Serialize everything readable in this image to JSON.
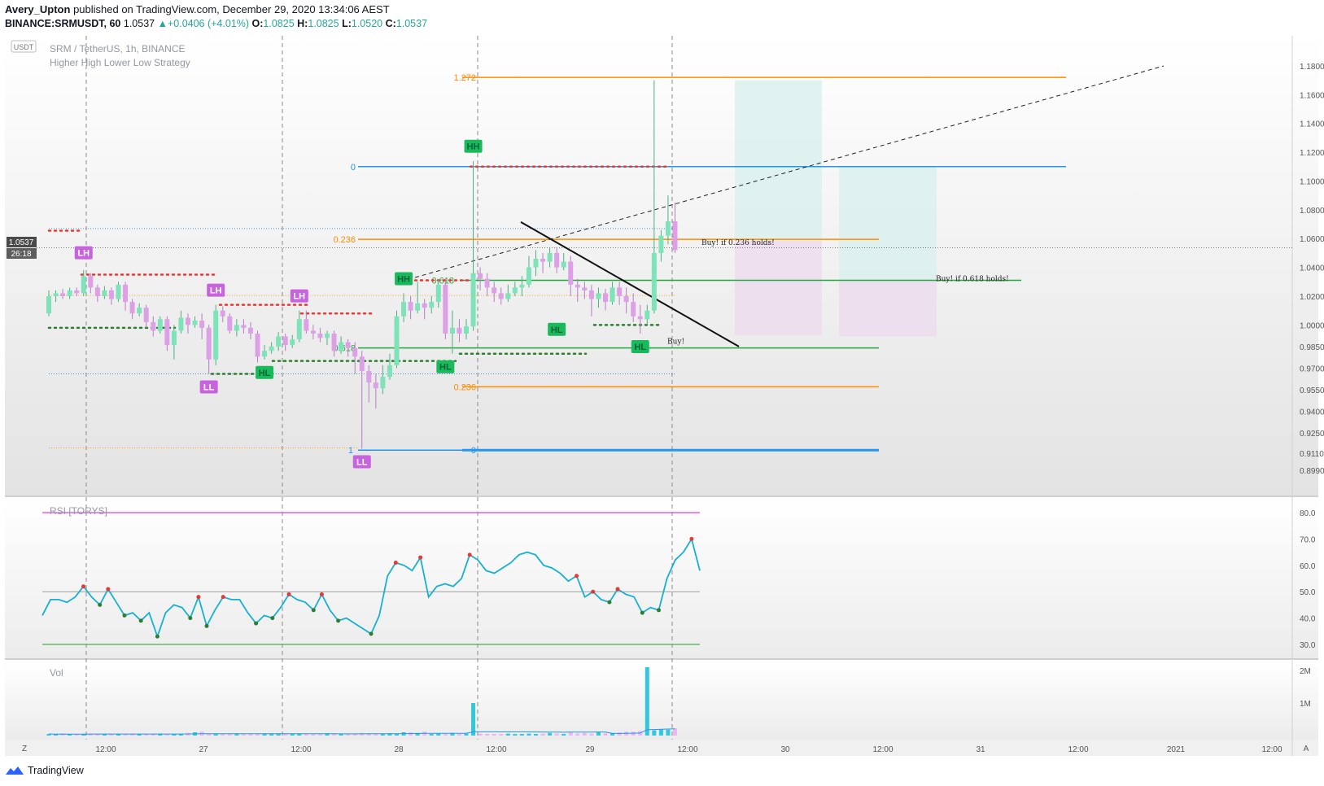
{
  "header": {
    "author": "Avery_Upton",
    "published": "published on TradingView.com, December 29, 2020 13:34:06 AEST",
    "symbol_line": "BINANCE:SRMUSDT, 60",
    "last": "1.0537",
    "change": "+0.0406 (+4.01%)",
    "o_label": "O:",
    "o_val": "1.0825",
    "h_label": "H:",
    "h_val": "1.0825",
    "l_label": "L:",
    "l_val": "1.0520",
    "c_label": "C:",
    "c_val": "1.0537"
  },
  "legend": {
    "title": "SRM / TetherUS, 1h, BINANCE",
    "strategy": "Higher High Lower Low Strategy",
    "currency": "USDT",
    "rsi_label": "RSI [TORYS]",
    "vol_label": "Vol"
  },
  "price_badge": {
    "value": "1.0537",
    "countdown": "26:18"
  },
  "footer": {
    "brand": "TradingView"
  },
  "colors": {
    "up": "#7ee3b8",
    "down": "#dda0e6",
    "hh_green": "#1aba5c",
    "ll_purple": "#c763dc",
    "fib_orange": "#ff8c00",
    "fib_blue": "#2196f3",
    "fib_green": "#26a641",
    "rsi": "#16b1d0"
  },
  "chart_data": [
    {
      "type": "candlestick",
      "title": "SRM / TetherUS, 1h, BINANCE",
      "y_ticks": [
        "1.1800",
        "1.1600",
        "1.1400",
        "1.1200",
        "1.1000",
        "1.0800",
        "1.0600",
        "1.0400",
        "1.0200",
        "1.0000",
        "0.9850",
        "0.9700",
        "0.9550",
        "0.9400",
        "0.9250",
        "0.9110",
        "0.8990"
      ],
      "x_ticks": [
        "12:00",
        "27",
        "12:00",
        "28",
        "12:00",
        "29",
        "12:00",
        "30",
        "12:00",
        "31",
        "12:00",
        "2021",
        "12:00"
      ],
      "candles": [
        [
          1.008,
          1.02,
          1.024,
          1.006
        ],
        [
          1.02,
          1.022,
          1.024,
          1.016
        ],
        [
          1.022,
          1.02,
          1.025,
          1.018
        ],
        [
          1.02,
          1.024,
          1.026,
          1.018
        ],
        [
          1.024,
          1.022,
          1.026,
          1.02
        ],
        [
          1.022,
          1.034,
          1.038,
          1.02
        ],
        [
          1.034,
          1.026,
          1.036,
          1.022
        ],
        [
          1.026,
          1.02,
          1.028,
          1.016
        ],
        [
          1.02,
          1.024,
          1.027,
          1.018
        ],
        [
          1.024,
          1.018,
          1.026,
          1.014
        ],
        [
          1.018,
          1.028,
          1.03,
          1.016
        ],
        [
          1.028,
          1.016,
          1.03,
          1.01
        ],
        [
          1.016,
          1.008,
          1.018,
          1.004
        ],
        [
          1.008,
          1.012,
          1.015,
          1.006
        ],
        [
          1.012,
          1.002,
          1.014,
          0.998
        ],
        [
          1.002,
          0.996,
          1.006,
          0.992
        ],
        [
          0.996,
          1.004,
          1.006,
          0.994
        ],
        [
          1.004,
          0.986,
          1.006,
          0.982
        ],
        [
          0.986,
          0.996,
          1.0,
          0.976
        ],
        [
          0.996,
          1.005,
          1.01,
          0.994
        ],
        [
          1.005,
          1.0,
          1.008,
          0.994
        ],
        [
          1.0,
          1.003,
          1.006,
          0.998
        ],
        [
          1.003,
          0.998,
          1.008,
          0.99
        ],
        [
          0.998,
          0.976,
          1.0,
          0.966
        ],
        [
          0.976,
          1.01,
          1.014,
          0.972
        ],
        [
          1.01,
          1.006,
          1.013,
          1.002
        ],
        [
          1.006,
          0.996,
          1.008,
          0.994
        ],
        [
          0.996,
          1.0,
          1.004,
          0.992
        ],
        [
          1.0,
          0.998,
          1.004,
          0.994
        ],
        [
          0.998,
          0.994,
          1.002,
          0.99
        ],
        [
          0.994,
          0.978,
          0.996,
          0.974
        ],
        [
          0.978,
          0.982,
          0.986,
          0.976
        ],
        [
          0.982,
          0.985,
          0.988,
          0.98
        ],
        [
          0.985,
          0.992,
          0.995,
          0.982
        ],
        [
          0.992,
          0.986,
          0.994,
          0.982
        ],
        [
          0.986,
          0.99,
          0.993,
          0.984
        ],
        [
          0.99,
          1.004,
          1.01,
          0.988
        ],
        [
          1.004,
          0.996,
          1.01,
          0.994
        ],
        [
          0.996,
          0.994,
          1.0,
          0.99
        ],
        [
          0.994,
          0.991,
          0.998,
          0.988
        ],
        [
          0.991,
          0.994,
          0.996,
          0.986
        ],
        [
          0.994,
          0.982,
          0.996,
          0.978
        ],
        [
          0.982,
          0.988,
          0.992,
          0.98
        ],
        [
          0.988,
          0.984,
          0.99,
          0.978
        ],
        [
          0.984,
          0.978,
          0.988,
          0.966
        ],
        [
          0.978,
          0.968,
          0.982,
          0.914
        ],
        [
          0.968,
          0.96,
          0.972,
          0.946
        ],
        [
          0.96,
          0.956,
          0.966,
          0.942
        ],
        [
          0.956,
          0.964,
          0.972,
          0.952
        ],
        [
          0.964,
          0.972,
          0.98,
          0.962
        ],
        [
          0.972,
          1.006,
          1.01,
          0.97
        ],
        [
          1.006,
          1.016,
          1.022,
          1.002
        ],
        [
          1.016,
          1.01,
          1.02,
          1.004
        ],
        [
          1.01,
          1.015,
          1.03,
          1.008
        ],
        [
          1.015,
          1.012,
          1.018,
          1.004
        ],
        [
          1.012,
          1.016,
          1.02,
          1.008
        ],
        [
          1.016,
          1.028,
          1.032,
          1.012
        ],
        [
          1.028,
          0.994,
          1.031,
          0.99
        ],
        [
          0.994,
          0.998,
          1.01,
          0.98
        ],
        [
          0.998,
          0.994,
          1.004,
          0.988
        ],
        [
          0.994,
          0.999,
          1.004,
          0.99
        ],
        [
          0.999,
          1.036,
          1.114,
          0.996
        ],
        [
          1.036,
          1.032,
          1.04,
          1.024
        ],
        [
          1.032,
          1.026,
          1.036,
          1.02
        ],
        [
          1.026,
          1.022,
          1.03,
          1.016
        ],
        [
          1.022,
          1.018,
          1.026,
          1.014
        ],
        [
          1.018,
          1.022,
          1.028,
          1.016
        ],
        [
          1.022,
          1.026,
          1.03,
          1.02
        ],
        [
          1.026,
          1.028,
          1.034,
          1.02
        ],
        [
          1.028,
          1.04,
          1.048,
          1.026
        ],
        [
          1.04,
          1.046,
          1.052,
          1.034
        ],
        [
          1.046,
          1.044,
          1.05,
          1.036
        ],
        [
          1.044,
          1.05,
          1.054,
          1.04
        ],
        [
          1.05,
          1.04,
          1.054,
          1.036
        ],
        [
          1.04,
          1.044,
          1.05,
          1.038
        ],
        [
          1.044,
          1.028,
          1.048,
          1.02
        ],
        [
          1.028,
          1.026,
          1.032,
          1.016
        ],
        [
          1.026,
          1.024,
          1.03,
          1.018
        ],
        [
          1.024,
          1.018,
          1.028,
          1.006
        ],
        [
          1.018,
          1.022,
          1.026,
          1.012
        ],
        [
          1.022,
          1.016,
          1.025,
          1.01
        ],
        [
          1.016,
          1.026,
          1.03,
          1.014
        ],
        [
          1.026,
          1.02,
          1.03,
          1.014
        ],
        [
          1.02,
          1.016,
          1.026,
          1.008
        ],
        [
          1.016,
          1.006,
          1.022,
          1.002
        ],
        [
          1.006,
          1.004,
          1.014,
          0.994
        ],
        [
          1.004,
          1.01,
          1.014,
          1.0
        ],
        [
          1.01,
          1.05,
          1.17,
          1.008
        ],
        [
          1.05,
          1.062,
          1.066,
          1.044
        ],
        [
          1.062,
          1.072,
          1.09,
          1.056
        ],
        [
          1.072,
          1.052,
          1.085,
          1.05
        ]
      ],
      "signals": [
        {
          "label": "LH",
          "i": 5,
          "price": 1.04,
          "pos": "above"
        },
        {
          "label": "LL",
          "i": 23,
          "price": 0.966,
          "pos": "below"
        },
        {
          "label": "LH",
          "i": 24,
          "price": 1.014,
          "pos": "above"
        },
        {
          "label": "HL",
          "i": 31,
          "price": 0.976,
          "pos": "below"
        },
        {
          "label": "LH",
          "i": 36,
          "price": 1.01,
          "pos": "above"
        },
        {
          "label": "LL",
          "i": 45,
          "price": 0.914,
          "pos": "below"
        },
        {
          "label": "HH",
          "i": 51,
          "price": 1.022,
          "pos": "above"
        },
        {
          "label": "HL",
          "i": 57,
          "price": 0.98,
          "pos": "below"
        },
        {
          "label": "HH",
          "i": 61,
          "price": 1.114,
          "pos": "above"
        },
        {
          "label": "HL",
          "i": 73,
          "price": 1.006,
          "pos": "below"
        },
        {
          "label": "HL",
          "i": 85,
          "price": 0.994,
          "pos": "below"
        }
      ],
      "fib_levels": [
        {
          "label": "1.272",
          "price": 1.172,
          "color": "#ff8c00"
        },
        {
          "label": "0",
          "price": 1.11,
          "color": "#2196f3"
        },
        {
          "label": "0.236",
          "price": 1.0595,
          "color": "#ff8c00"
        },
        {
          "label": "0.618",
          "price": 1.031,
          "color": "#26a641"
        },
        {
          "label": "0.618",
          "price": 0.984,
          "color": "#26a641"
        },
        {
          "label": "0.236",
          "price": 0.957,
          "color": "#ff8c00"
        },
        {
          "label": "1",
          "price": 0.913,
          "color": "#2196f3"
        },
        {
          "label": "0",
          "price": 0.913,
          "color": "#2196f3"
        }
      ],
      "annotations": [
        "Buy! if 0.236 holds!",
        "Buy! if 0.618 holds!",
        "Buy!"
      ]
    },
    {
      "type": "line",
      "title": "RSI [TORYS]",
      "y_ticks": [
        "80.0",
        "70.0",
        "60.0",
        "50.0",
        "40.0",
        "30.0"
      ],
      "levels": [
        80,
        50,
        30
      ],
      "values": [
        41,
        47,
        47,
        46,
        48,
        52,
        48,
        45,
        51,
        46,
        41,
        42,
        39,
        42,
        33,
        42,
        45,
        44,
        40,
        48,
        37,
        43,
        48,
        47,
        47,
        42,
        38,
        41,
        40,
        44,
        49,
        47,
        46,
        43,
        49,
        43,
        39,
        40,
        38,
        36,
        34,
        41,
        56,
        61,
        60,
        58,
        63,
        48,
        52,
        53,
        52,
        55,
        64,
        62,
        58,
        57,
        59,
        61,
        64,
        65,
        64,
        60,
        59,
        57,
        54,
        56,
        48,
        50,
        47,
        46,
        51,
        49,
        48,
        42,
        44,
        43,
        55,
        62,
        65,
        70,
        58
      ]
    },
    {
      "type": "bar",
      "title": "Vol",
      "y_ticks": [
        "2M",
        "1M"
      ],
      "values": [
        0.05,
        0.04,
        0.05,
        0.04,
        0.05,
        0.04,
        0.06,
        0.05,
        0.04,
        0.05,
        0.04,
        0.05,
        0.06,
        0.05,
        0.04,
        0.05,
        0.06,
        0.05,
        0.04,
        0.05,
        0.08,
        0.1,
        0.12,
        0.05,
        0.06,
        0.05,
        0.04,
        0.05,
        0.06,
        0.05,
        0.04,
        0.05,
        0.06,
        0.05,
        0.04,
        0.05,
        0.06,
        0.05,
        0.05,
        0.06,
        0.07,
        0.05,
        0.04,
        0.05,
        0.06,
        0.08,
        0.07,
        0.06,
        0.05,
        0.07,
        0.06,
        0.1,
        0.1,
        0.08,
        0.12,
        0.05,
        0.06,
        0.05,
        0.08,
        0.05,
        0.06,
        1.0,
        0.06,
        0.05,
        0.04,
        0.05,
        0.06,
        0.05,
        0.05,
        0.06,
        0.05,
        0.06,
        0.08,
        0.06,
        0.05,
        0.1,
        0.06,
        0.08,
        0.06,
        0.1,
        0.08,
        0.08,
        0.1,
        0.12,
        0.12,
        0.14,
        2.1,
        0.16,
        0.2,
        0.18,
        0.22
      ]
    }
  ]
}
